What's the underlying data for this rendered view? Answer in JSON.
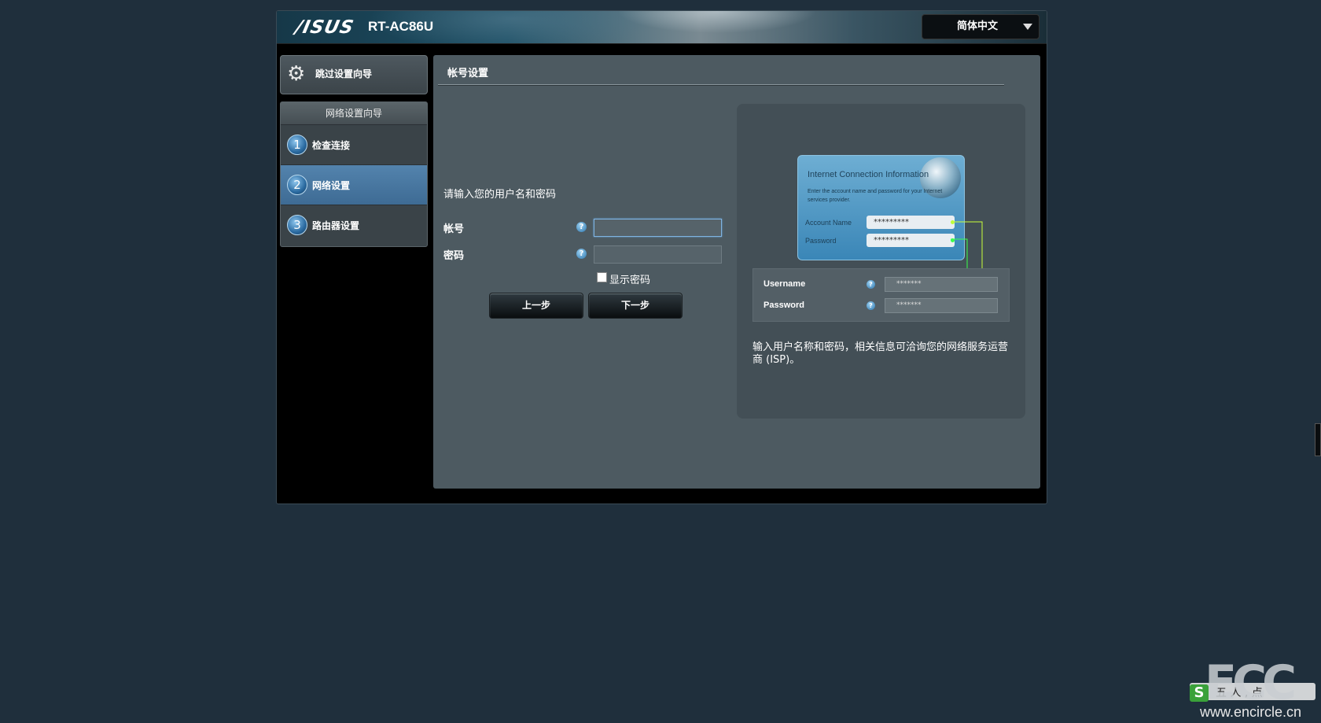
{
  "header": {
    "brand": "/ISUS",
    "model": "RT-AC86U",
    "language": "简体中文"
  },
  "sidebar": {
    "skip_label": "跳过设置向导",
    "wizard_title": "网络设置向导",
    "steps": [
      {
        "num": "1",
        "label": "检查连接"
      },
      {
        "num": "2",
        "label": "网络设置"
      },
      {
        "num": "3",
        "label": "路由器设置"
      }
    ],
    "active_step": 2
  },
  "main": {
    "title": "帐号设置",
    "prompt": "请输入您的用户名和密码",
    "account_label": "帐号",
    "password_label": "密码",
    "account_value": "",
    "password_value": "",
    "show_password_label": "显示密码",
    "prev_button": "上一步",
    "next_button": "下一步",
    "help_glyph": "?"
  },
  "info_panel": {
    "card_title": "Internet Connection Information",
    "card_desc": "Enter the account name and password for your Internet services provider.",
    "card_account_label": "Account Name",
    "card_password_label": "Password",
    "card_mask": "*********",
    "mini_username_label": "Username",
    "mini_password_label": "Password",
    "mini_mask": "*******",
    "description": "输入用户名称和密码，相关信息可洽询您的网络服务运营商 (ISP)。"
  },
  "watermark": {
    "logo": "ECC",
    "badge": "S",
    "cn_text": "五 人 , 点 ",
    "url": "www.encircle.cn"
  },
  "colors": {
    "background": "#1f2f3c",
    "active_step": "#4a79a3",
    "content_panel": "#4d5a61"
  }
}
